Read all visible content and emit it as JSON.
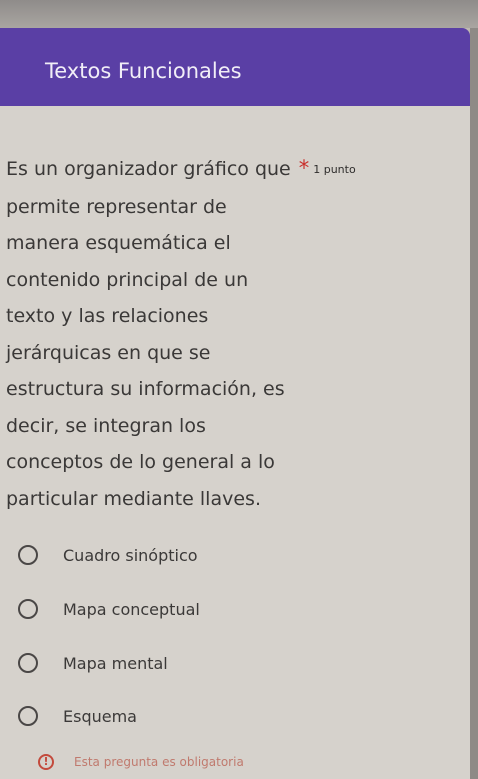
{
  "header": {
    "title": "Textos Funcionales",
    "accent_color": "#5a3fa5"
  },
  "question": {
    "lines": [
      "Es un organizador gráfico que",
      "permite representar de",
      "manera esquemática el",
      "contenido principal de un",
      "texto y las relaciones",
      "jerárquicas en que se",
      "estructura su información, es",
      "decir, se integran los",
      "conceptos de lo general a lo",
      "particular mediante llaves."
    ],
    "required_mark": "*",
    "points": "1 punto"
  },
  "options": [
    {
      "label": "Cuadro sinóptico",
      "selected": false
    },
    {
      "label": "Mapa conceptual",
      "selected": false
    },
    {
      "label": "Mapa mental",
      "selected": false
    },
    {
      "label": "Esquema",
      "selected": false
    }
  ],
  "footer": {
    "icon": "exclamation-circle-icon",
    "text": "Esta pregunta es obligatoria"
  }
}
